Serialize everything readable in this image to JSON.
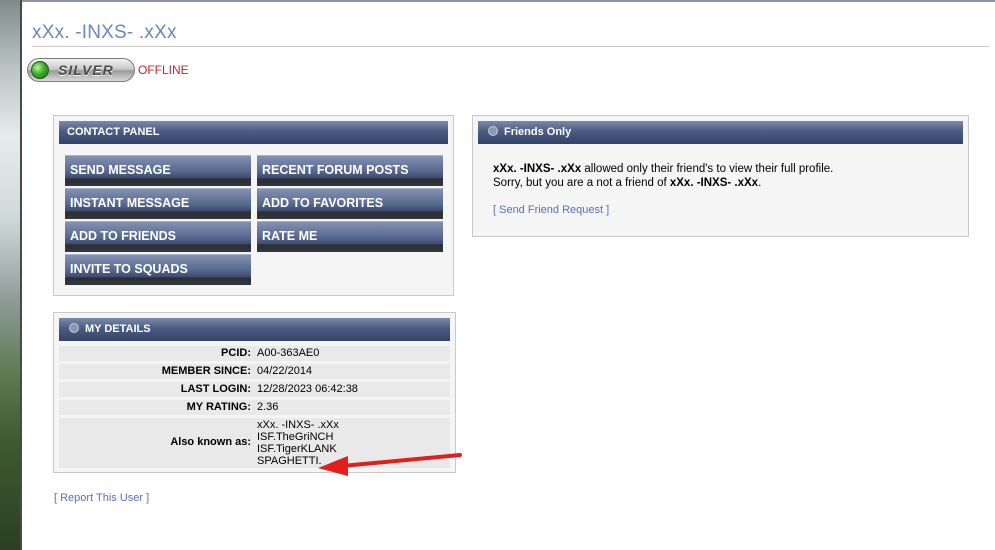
{
  "profile": {
    "username": "xXx. -INXS- .xXx",
    "badge": "SILVER",
    "status": "OFFLINE"
  },
  "contact_panel": {
    "title": "CONTACT PANEL",
    "buttons": [
      "SEND MESSAGE",
      "RECENT FORUM POSTS",
      "INSTANT MESSAGE",
      "ADD TO FAVORITES",
      "ADD TO FRIENDS",
      "RATE ME",
      "INVITE TO SQUADS"
    ]
  },
  "my_details": {
    "title": "MY DETAILS",
    "rows": [
      {
        "label": "PCID:",
        "value": "A00-363AE0"
      },
      {
        "label": "MEMBER SINCE:",
        "value": "04/22/2014"
      },
      {
        "label": "LAST LOGIN:",
        "value": "12/28/2023 06:42:38"
      },
      {
        "label": "MY RATING:",
        "value": "2.36"
      }
    ],
    "aka_label": "Also known as:",
    "aka": [
      "xXx. -INXS- .xXx",
      "ISF.TheGriNCH",
      "ISF.TigerKLANK",
      "SPAGHETTI."
    ]
  },
  "report_link": "[ Report This User ]",
  "friends_only": {
    "title": "Friends Only",
    "line1_name": "xXx. -INXS- .xXx",
    "line1_rest": " allowed only their friend's to view their full profile.",
    "line2_pre": "Sorry, but you are a not a friend of ",
    "line2_name": "xXx. -INXS- .xXx",
    "line2_end": ".",
    "request_link": "[ Send Friend Request ]"
  },
  "colors": {
    "username": "#6b86c4",
    "status": "#c0262c",
    "header": "#3a4a72",
    "link": "#5a6fbf",
    "annotation_arrow": "#e0201c"
  }
}
